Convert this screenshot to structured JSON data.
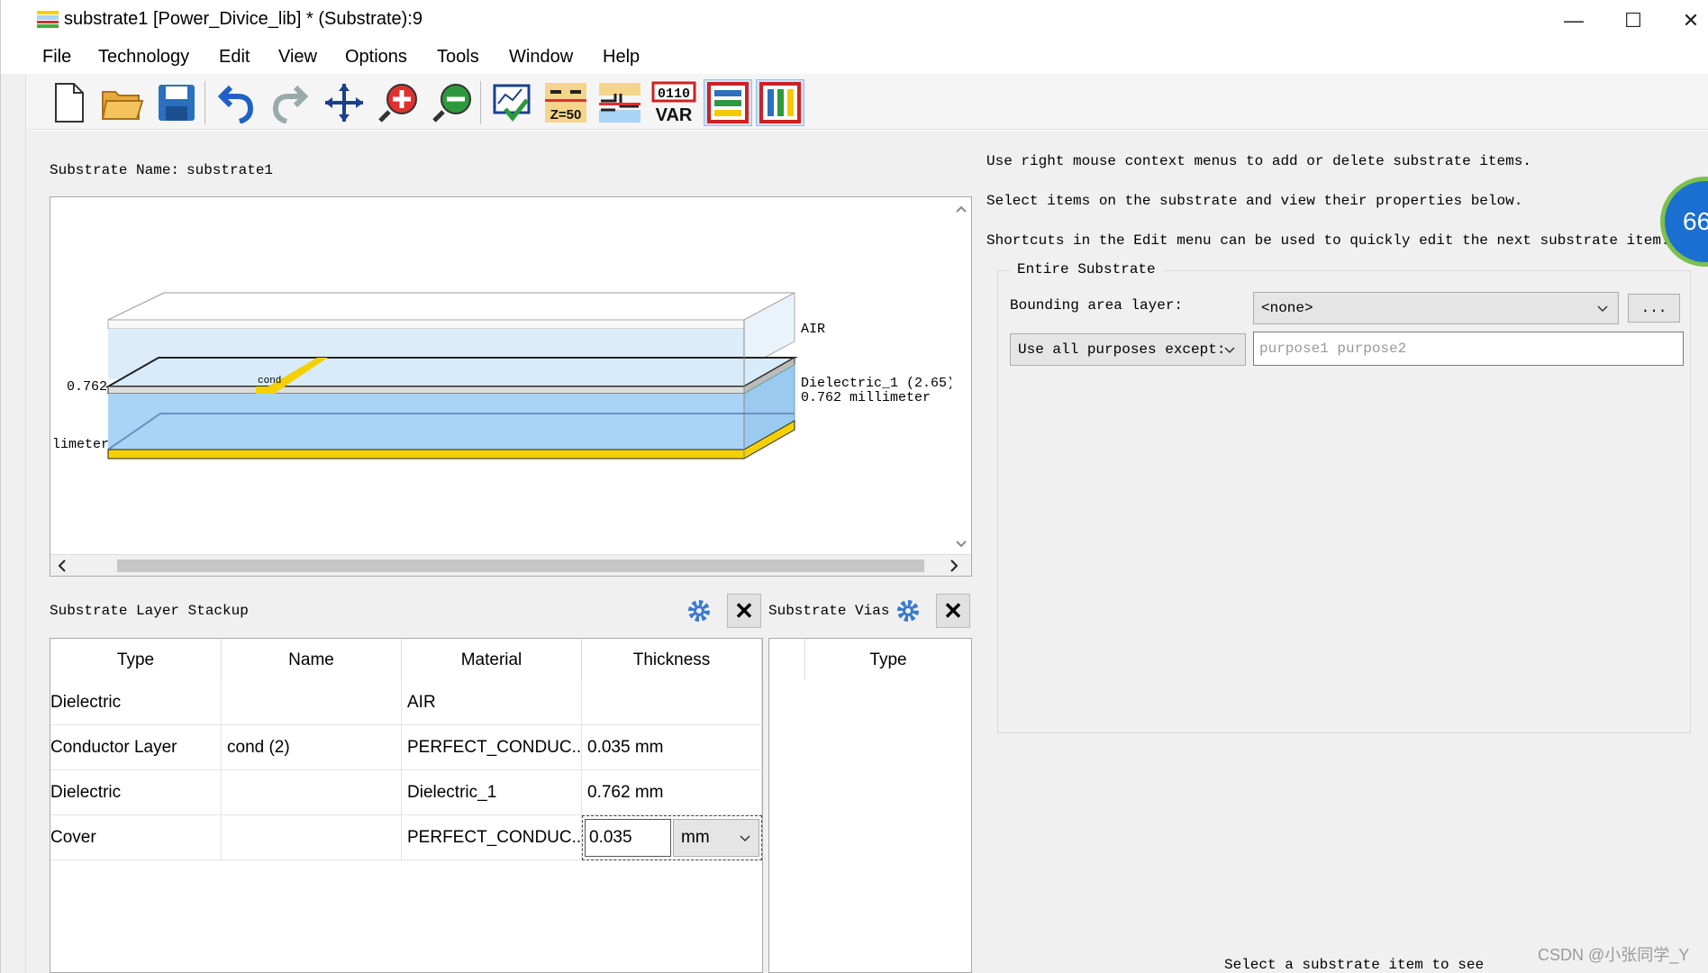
{
  "window": {
    "title": "substrate1 [Power_Divice_lib] * (Substrate):9",
    "minimize": "—",
    "maximize": "☐",
    "close": "✕"
  },
  "menu": [
    "File",
    "Technology",
    "Edit",
    "View",
    "Options",
    "Tools",
    "Window",
    "Help"
  ],
  "toolbar": {
    "icons": [
      "new-document-icon",
      "open-folder-icon",
      "save-icon",
      "undo-icon",
      "redo-icon",
      "pan-icon",
      "zoom-in-icon",
      "zoom-out-icon",
      "check-icon",
      "impedance-z50-icon",
      "transmission-line-icon",
      "variables-icon",
      "horizontal-layers-icon",
      "vertical-layers-icon"
    ],
    "z50_label": "Z=50",
    "var_top": "0110",
    "var_bottom": "VAR"
  },
  "substrate": {
    "name_label": "Substrate Name:",
    "name_value": "substrate1"
  },
  "viewer": {
    "air_label": "AIR",
    "cond_label": "cond",
    "left_thickness": "0.762",
    "left_unit": "limeter",
    "dielectric_label": "Dielectric_1 (2.65)",
    "dielectric_thickness": "0.762 millimeter"
  },
  "stackup": {
    "title": "Substrate Layer Stackup",
    "columns": [
      "Type",
      "Name",
      "Material",
      "Thickness"
    ],
    "rows": [
      {
        "type": "Dielectric",
        "name": "",
        "material": "AIR",
        "thickness": ""
      },
      {
        "type": "Conductor Layer",
        "name": "cond (2)",
        "material": "PERFECT_CONDUC...",
        "thickness": "0.035 mm"
      },
      {
        "type": "Dielectric",
        "name": "",
        "material": "Dielectric_1",
        "thickness": "0.762 mm"
      },
      {
        "type": "Cover",
        "name": "",
        "material": "PERFECT_CONDUC...",
        "thickness": ""
      }
    ],
    "edit_value": "0.035",
    "edit_unit": "mm"
  },
  "vias": {
    "title": "Substrate Vias",
    "column": "Type"
  },
  "info": {
    "line1": "Use right mouse context menus to add or delete substrate items.",
    "line2": "Select items on the substrate and view their properties below.",
    "line3": "Shortcuts in the Edit menu can be used to quickly edit the next substrate item.",
    "bottom_hint": "Select a substrate item to see"
  },
  "entire": {
    "title": "Entire Substrate",
    "bounding_label": "Bounding area layer:",
    "bounding_value": "<none>",
    "ellipsis": "...",
    "purpose_mode": "Use all purposes except:",
    "purpose_placeholder": "purpose1 purpose2"
  },
  "badge": "66",
  "watermark": "CSDN @小张同学_Y",
  "colors": {
    "gold": "#f5d000",
    "water": "#a9d4f5",
    "accent": "#1a6fd0"
  }
}
